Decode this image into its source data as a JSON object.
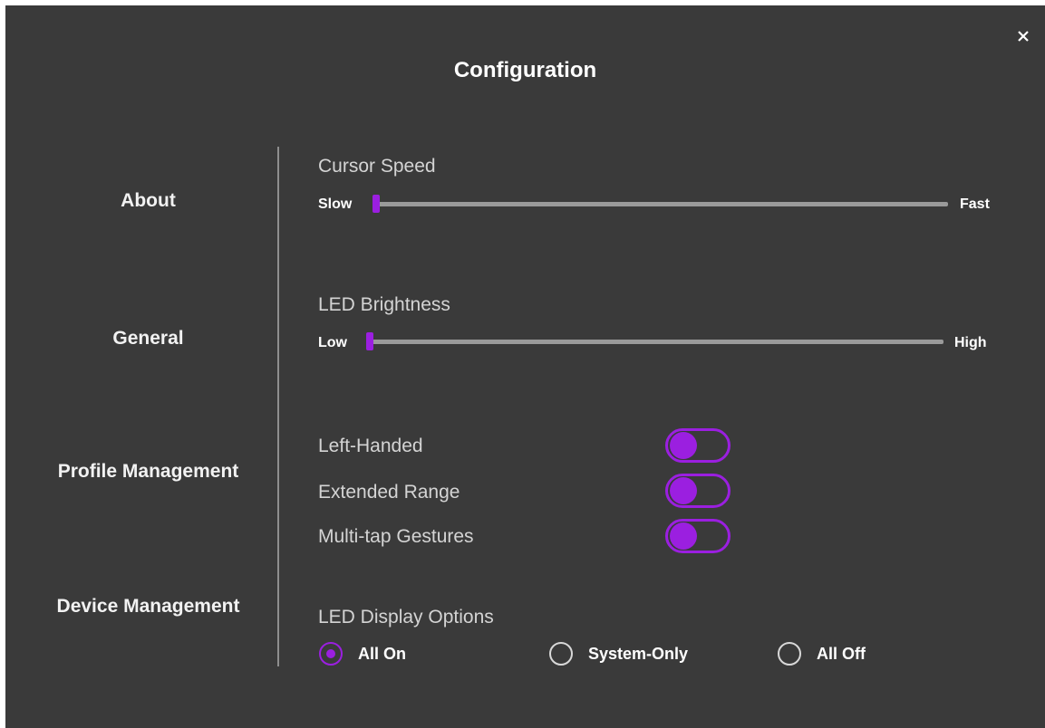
{
  "dialog": {
    "title": "Configuration",
    "close_icon": "close-icon"
  },
  "nav": {
    "items": [
      {
        "label": "About"
      },
      {
        "label": "General"
      },
      {
        "label": "Profile Management"
      },
      {
        "label": "Device Management"
      }
    ]
  },
  "cursor_speed": {
    "label": "Cursor Speed",
    "min_label": "Slow",
    "max_label": "Fast",
    "value_fraction": 0.0
  },
  "led_brightness": {
    "label": "LED Brightness",
    "min_label": "Low",
    "max_label": "High",
    "value_fraction": 0.0
  },
  "toggles": [
    {
      "label": "Left-Handed",
      "on": false
    },
    {
      "label": "Extended Range",
      "on": false
    },
    {
      "label": "Multi-tap Gestures",
      "on": false
    }
  ],
  "led_display": {
    "label": "LED Display Options",
    "options": [
      {
        "label": "All On",
        "selected": true
      },
      {
        "label": "System-Only",
        "selected": false
      },
      {
        "label": "All Off",
        "selected": false
      }
    ]
  },
  "colors": {
    "accent": "#9b1fe0",
    "background": "#3a3a3a",
    "track": "#9a9a9a"
  }
}
